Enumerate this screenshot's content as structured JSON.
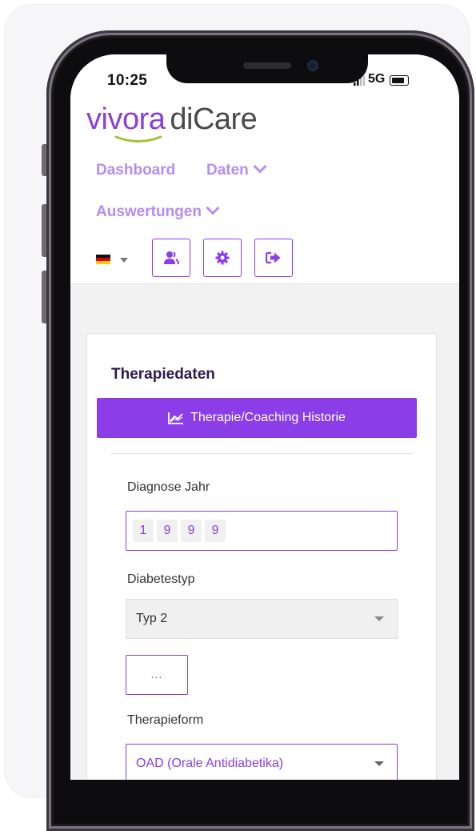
{
  "status_bar": {
    "time": "10:25",
    "network": "5G"
  },
  "app": {
    "logo_part1": "vivora",
    "logo_part2": "diCare"
  },
  "nav": {
    "dashboard": "Dashboard",
    "daten": "Daten",
    "auswertungen": "Auswertungen"
  },
  "toolbar": {
    "language_flag": "germany-flag-icon",
    "buttons": [
      "users-icon",
      "gear-icon",
      "logout-icon"
    ]
  },
  "therapy": {
    "title": "Therapiedaten",
    "history_button": "Therapie/Coaching Historie",
    "diagnosis_year_label": "Diagnose Jahr",
    "diagnosis_year_digits": [
      "1",
      "9",
      "9",
      "9"
    ],
    "diabetes_type_label": "Diabetestyp",
    "diabetes_type_value": "Typ 2",
    "more_button": "...",
    "therapy_form_label": "Therapieform",
    "therapy_form_value": "OAD (Orale Antidiabetika)"
  },
  "colors": {
    "accent": "#8b3ee8",
    "accent_light": "#b78cf0",
    "title": "#2c1a4d",
    "logo_gray": "#4a4a4a"
  }
}
